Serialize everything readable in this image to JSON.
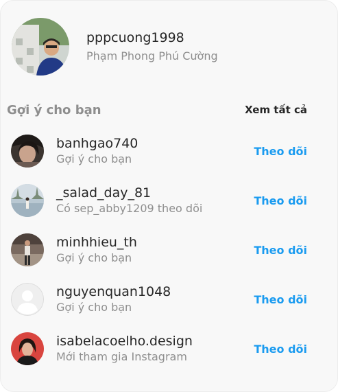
{
  "profile": {
    "username": "pppcuong1998",
    "full_name": "Phạm Phong Phú Cường"
  },
  "suggestions": {
    "title": "Gợi ý cho bạn",
    "see_all": "Xem tất cả",
    "items": [
      {
        "username": "banhgao740",
        "subtitle": "Gợi ý cho bạn",
        "action": "Theo dõi"
      },
      {
        "username": "_salad_day_81",
        "subtitle": "Có sep_abby1209 theo dõi",
        "action": "Theo dõi"
      },
      {
        "username": "minhhieu_th",
        "subtitle": "Gợi ý cho bạn",
        "action": "Theo dõi"
      },
      {
        "username": "nguyenquan1048",
        "subtitle": "Gợi ý cho bạn",
        "action": "Theo dõi"
      },
      {
        "username": "isabelacoelho.design",
        "subtitle": "Mới tham gia Instagram",
        "action": "Theo dõi"
      }
    ]
  },
  "colors": {
    "link_blue": "#1a9bf0",
    "text_primary": "#262626",
    "text_secondary": "#8e8e8e"
  }
}
